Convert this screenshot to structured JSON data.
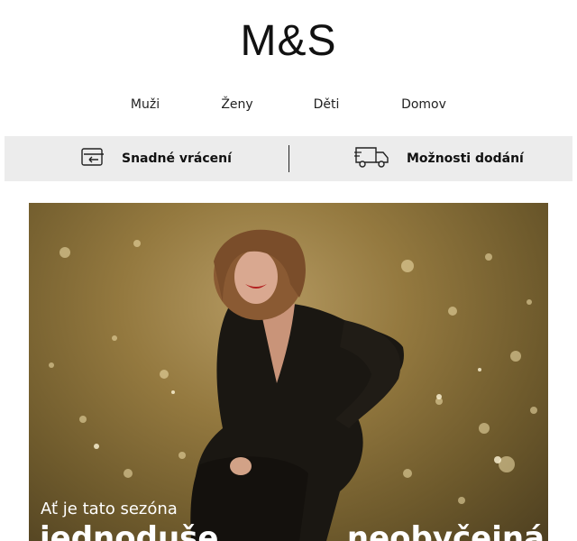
{
  "brand": {
    "logo_text": "M&S"
  },
  "nav": {
    "items": [
      "Muži",
      "Ženy",
      "Děti",
      "Domov"
    ]
  },
  "services": {
    "returns": {
      "label": "Snadné vrácení",
      "icon": "return-tag-icon"
    },
    "delivery": {
      "label": "Možnosti dodání",
      "icon": "delivery-truck-icon"
    }
  },
  "hero": {
    "kicker": "Ať je tato sezóna",
    "headline_left": "jednoduše",
    "headline_right": "neobyčejná",
    "colors": {
      "background": "#94793f",
      "text": "#ffffff"
    }
  }
}
